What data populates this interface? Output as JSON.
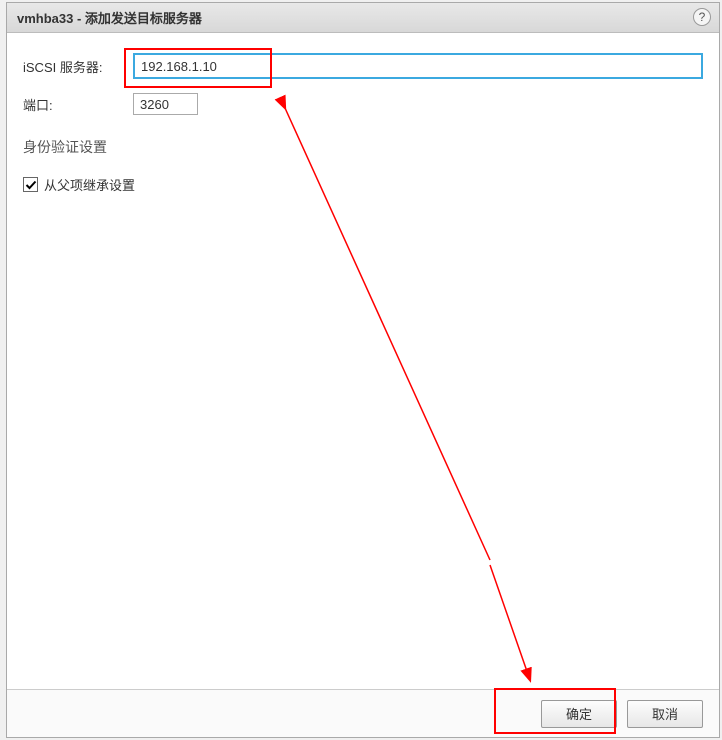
{
  "titlebar": {
    "title": "vmhba33 - 添加发送目标服务器"
  },
  "form": {
    "iscsi_label": "iSCSI 服务器:",
    "iscsi_value": "192.168.1.10",
    "port_label": "端口:",
    "port_value": "3260"
  },
  "auth": {
    "section_label": "身份验证设置",
    "inherit_label": "从父项继承设置",
    "inherit_checked": true
  },
  "footer": {
    "ok_label": "确定",
    "cancel_label": "取消"
  }
}
